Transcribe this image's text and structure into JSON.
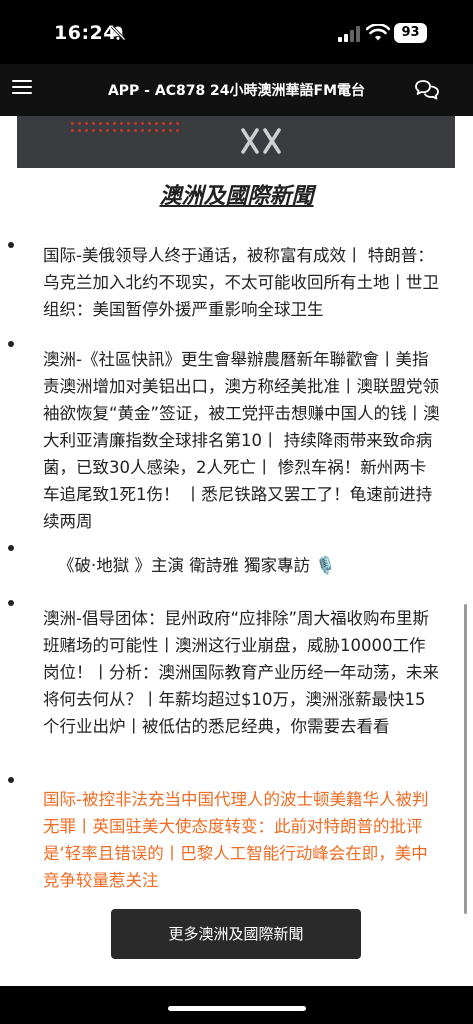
{
  "status_bar": {
    "time": "16:24",
    "battery": "93",
    "icons": [
      "bell-slash-icon",
      "signal-icon",
      "wifi-icon",
      "battery-icon"
    ]
  },
  "header": {
    "title": "APP - AC878 24小時澳洲華語FM電台",
    "menu_icon": "hamburger-menu-icon",
    "chat_icon": "chat-bubbles-icon"
  },
  "banner": {
    "logo_icon": "xx-logo-icon",
    "accent": "#c0392b"
  },
  "section": {
    "title": "澳洲及國際新聞"
  },
  "news": [
    {
      "text": "国际-美俄领导人终于通话，被称富有成效丨 特朗普：乌克兰加入北约不现实，不太可能收回所有土地丨世卫组织：美国暂停外援严重影响全球卫生",
      "color": "#222222"
    },
    {
      "text": "澳洲-《社區快訊》更生會舉辦農曆新年聯歡會丨美指责澳洲增加对美铝出口，澳方称经美批准丨澳联盟党领袖欲恢复“黄金”签证，被工党抨击想赚中国人的钱丨澳大利亚清廉指数全球排名第10丨 持续降雨带来致命病菌，已致30人感染，2人死亡丨 惨烈车祸！新州两卡车追尾致1死1伤！ 丨悉尼铁路又罢工了！龟速前进持续两周",
      "color": "#222222"
    },
    {
      "text": "《破·地獄 》主演 衛詩雅 獨家專訪 🎙️",
      "color": "#222222"
    },
    {
      "text": "澳洲-倡导团体：昆州政府“应排除”周大福收购布里斯班赌场的可能性丨澳洲这行业崩盘，威胁10000工作岗位！丨分析：澳洲国际教育产业历经一年动荡，未来将何去何从？丨年薪均超过$10万，澳洲涨薪最快15个行业出炉丨被低估的悉尼经典，你需要去看看",
      "color": "#222222"
    },
    {
      "text": "国际-被控非法充当中国代理人的波士顿美籍华人被判无罪丨英国驻美大使态度转变：此前对特朗普的批评是‘轻率且错误的丨巴黎人工智能行动峰会在即，美中竞争较量惹关注",
      "color": "#ef6c23"
    }
  ],
  "more_button": {
    "label": "更多澳洲及國際新聞"
  }
}
